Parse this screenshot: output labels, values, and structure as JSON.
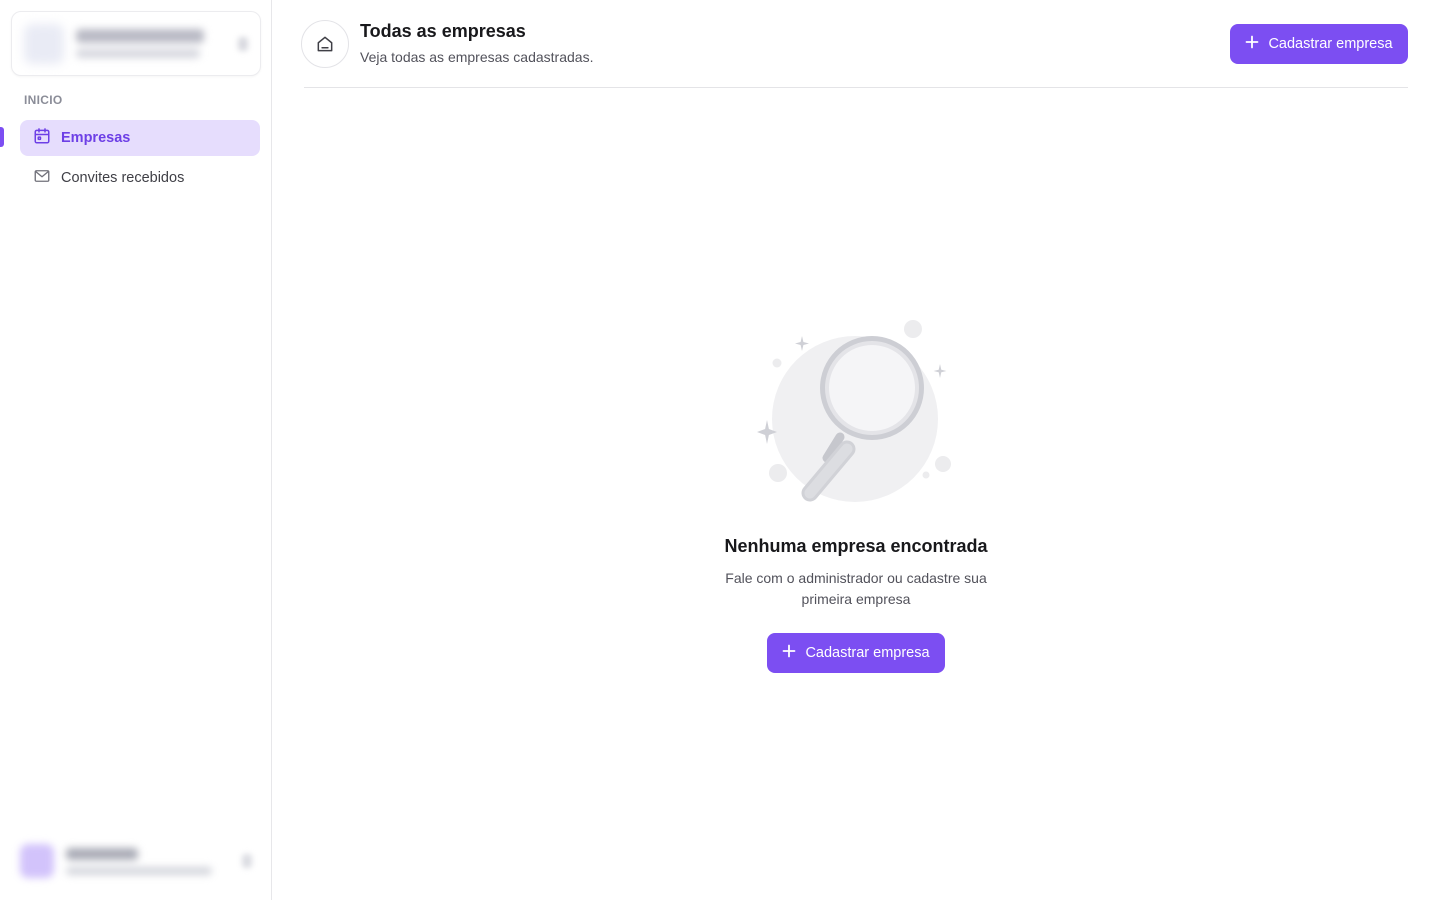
{
  "sidebar": {
    "section_label": "INICIO",
    "items": [
      {
        "label": "Empresas",
        "icon": "calendar-icon",
        "active": true
      },
      {
        "label": "Convites recebidos",
        "icon": "mail-icon",
        "active": false
      }
    ]
  },
  "header": {
    "icon": "home-icon",
    "title": "Todas as empresas",
    "subtitle": "Veja todas as empresas cadastradas.",
    "primary_button": "Cadastrar empresa"
  },
  "empty_state": {
    "illustration": "magnifying-glass-icon",
    "title": "Nenhuma empresa encontrada",
    "description": "Fale com o administrador ou cadastre sua primeira empresa",
    "button": "Cadastrar empresa"
  },
  "colors": {
    "accent": "#7c4ef2",
    "accent_soft": "#e6ddfd",
    "border": "#e4e4e7",
    "text_muted": "#52525b"
  }
}
